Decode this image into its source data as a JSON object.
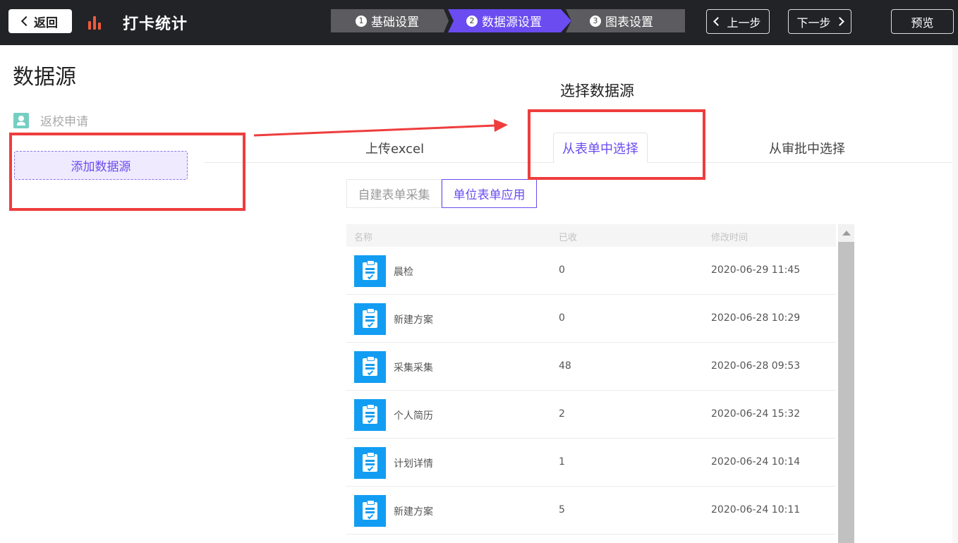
{
  "header": {
    "back_label": "返回",
    "app_title": "打卡统计",
    "steps": [
      {
        "num": "1",
        "label": "基础设置"
      },
      {
        "num": "2",
        "label": "数据源设置"
      },
      {
        "num": "3",
        "label": "图表设置"
      }
    ],
    "active_step": 2,
    "prev_label": "上一步",
    "next_label": "下一步",
    "preview_label": "预览",
    "accent_color": "#6a4cf0"
  },
  "sidebar": {
    "title": "数据源",
    "items": [
      {
        "label": "返校申请",
        "icon": "user-card-icon"
      }
    ],
    "add_label": "添加数据源"
  },
  "main": {
    "title": "选择数据源",
    "tabs": [
      {
        "label": "上传excel"
      },
      {
        "label": "从表单中选择",
        "active": true
      },
      {
        "label": "从审批中选择"
      }
    ],
    "subtabs": [
      {
        "label": "自建表单采集"
      },
      {
        "label": "单位表单应用",
        "active": true
      }
    ],
    "table": {
      "columns": [
        "名称",
        "已收",
        "修改时间"
      ],
      "rows": [
        {
          "name": "晨检",
          "received": "0",
          "modified": "2020-06-29 11:45"
        },
        {
          "name": "新建方案",
          "received": "0",
          "modified": "2020-06-28 10:29"
        },
        {
          "name": "采集采集",
          "received": "48",
          "modified": "2020-06-28 09:53"
        },
        {
          "name": "个人简历",
          "received": "2",
          "modified": "2020-06-24 15:32"
        },
        {
          "name": "计划详情",
          "received": "1",
          "modified": "2020-06-24 10:14"
        },
        {
          "name": "新建方案",
          "received": "5",
          "modified": "2020-06-24 10:11"
        }
      ]
    }
  },
  "annotation_color": "#ef3d3d"
}
